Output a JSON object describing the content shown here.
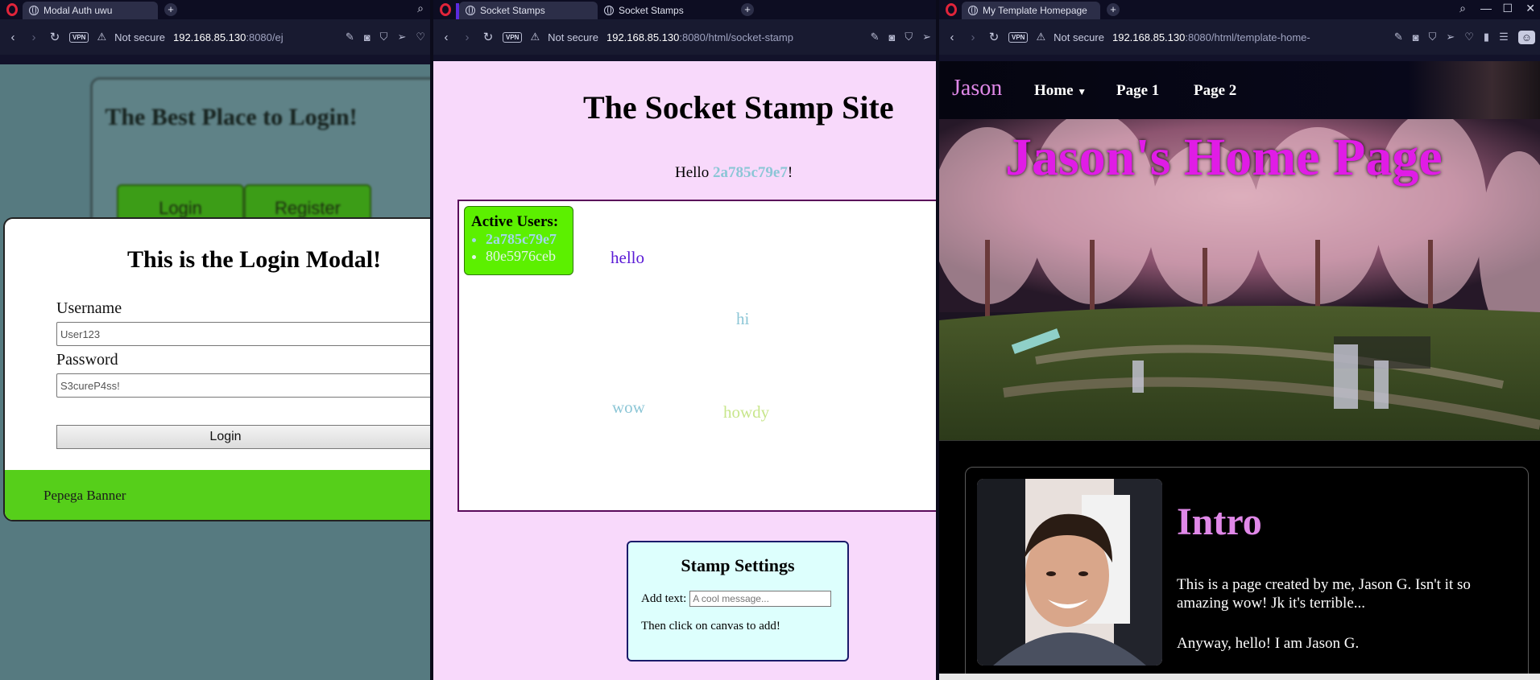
{
  "windows": [
    {
      "tabs": [
        {
          "title": "Modal Auth uwu"
        }
      ],
      "url": {
        "host": "192.168.85.130",
        "rest": ":8080/ej"
      },
      "security": "Not secure",
      "page": {
        "background_title": "The Best Place to Login!",
        "bg_login": "Login",
        "bg_register": "Register",
        "modal_title": "This is the Login Modal!",
        "username_label": "Username",
        "username_value": "User123",
        "password_label": "Password",
        "password_value": "S3cureP4ss!",
        "login_button": "Login",
        "banner": "Pepega Banner"
      }
    },
    {
      "tabs": [
        {
          "title": "Socket Stamps"
        },
        {
          "title": "Socket Stamps"
        }
      ],
      "url": {
        "host": "192.168.85.130",
        "rest": ":8080/html/socket-stamp"
      },
      "security": "Not secure",
      "page": {
        "title": "The Socket Stamp Site",
        "hello_prefix": "Hello ",
        "hello_user": "2a785c79e7",
        "hello_suffix": "!",
        "active_users_title": "Active Users:",
        "active_users": [
          "2a785c79e7",
          "80e5976ceb"
        ],
        "stamps": [
          {
            "text": "hello",
            "color": "#5a1ad6"
          },
          {
            "text": "hi",
            "color": "#8cc6d6"
          },
          {
            "text": "wow",
            "color": "#8cc6d6"
          },
          {
            "text": "howdy",
            "color": "#c8e68c"
          }
        ],
        "settings_title": "Stamp Settings",
        "add_text_label": "Add text:",
        "add_text_placeholder": "A cool message...",
        "settings_note": "Then click on canvas to add!"
      }
    },
    {
      "tabs": [
        {
          "title": "My Template Homepage"
        }
      ],
      "url": {
        "host": "192.168.85.130",
        "rest": ":8080/html/template-home-"
      },
      "security": "Not secure",
      "page": {
        "brand": "Jason",
        "nav": [
          "Home",
          "Page 1",
          "Page 2"
        ],
        "hero_title": "Jason's Home Page",
        "intro_title": "Intro",
        "intro_text": "This is a page created by me, Jason G. Isn't it so amazing wow! Jk it's terrible...",
        "intro_text2": "Anyway, hello! I am Jason G."
      }
    }
  ],
  "colors": {
    "accent_pink": "#e088e8",
    "hero_magenta": "#e01ce6",
    "banner_green": "#56cf1a",
    "users_green": "#5cf000"
  }
}
